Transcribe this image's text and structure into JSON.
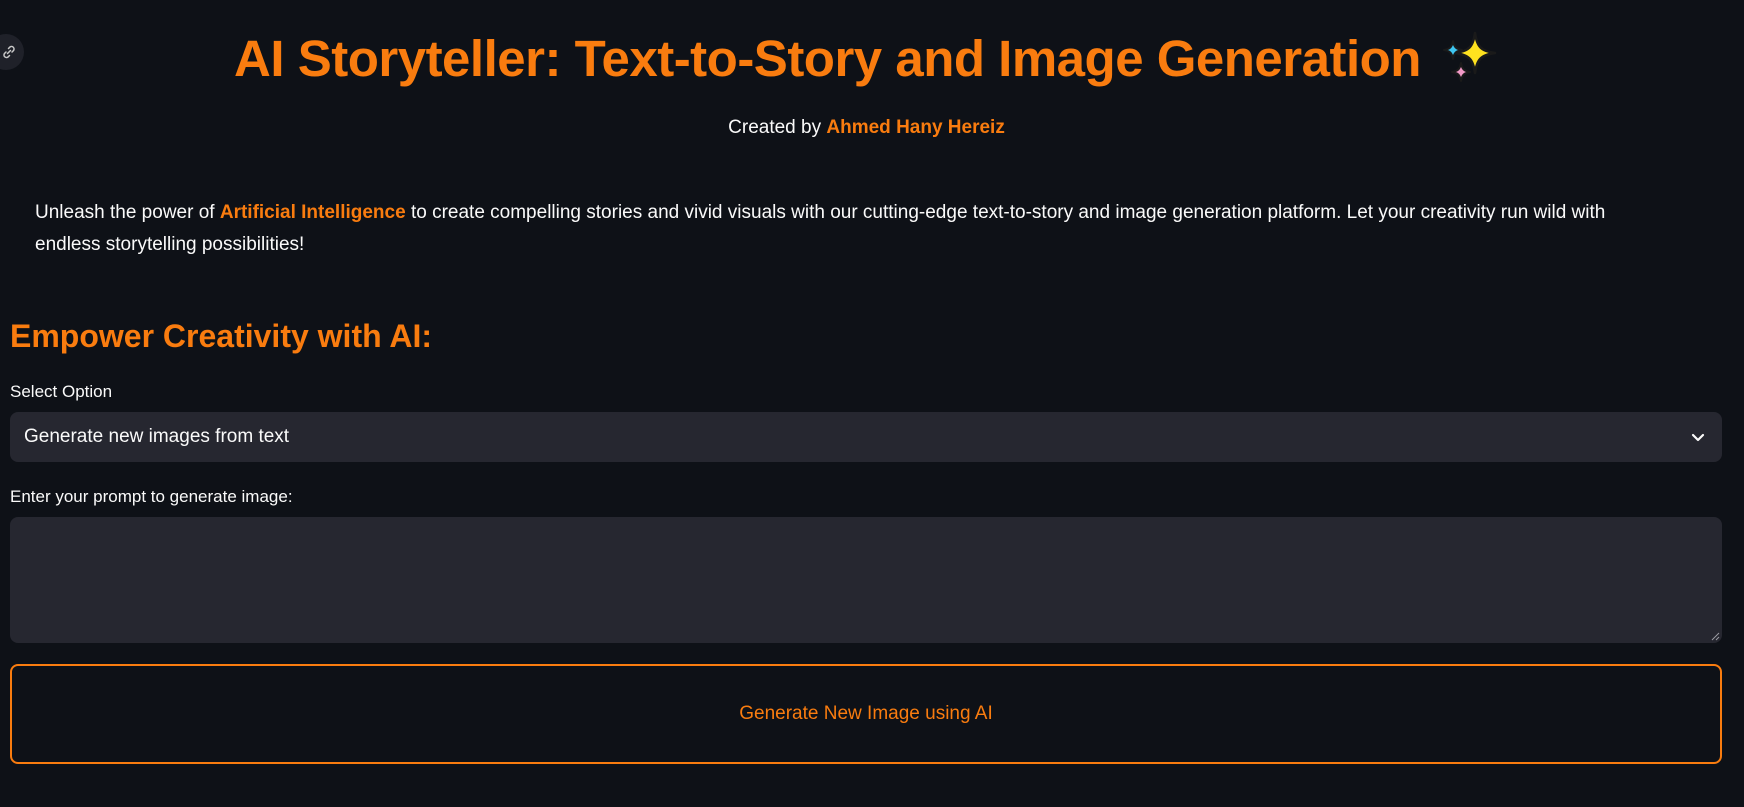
{
  "header": {
    "title": "AI Storyteller: Text-to-Story and Image Generation",
    "title_icon": "sparkles-icon",
    "credit_prefix": "Created by",
    "credit_author": "Ahmed Hany Hereiz"
  },
  "intro": {
    "prefix": "Unleash the power of",
    "highlight": "Artificial Intelligence",
    "suffix": "to create compelling stories and vivid visuals with our cutting-edge text-to-story and image generation platform. Let your creativity run wild with endless storytelling possibilities!"
  },
  "section": {
    "heading": "Empower Creativity with AI:"
  },
  "form": {
    "select_label": "Select Option",
    "select_value": "Generate new images from text",
    "prompt_label": "Enter your prompt to generate image:",
    "prompt_value": "",
    "button_label": "Generate New Image using AI"
  },
  "colors": {
    "background": "#0e1117",
    "accent": "#f97c0f",
    "input_bg": "#262730",
    "text": "#fafafa"
  }
}
